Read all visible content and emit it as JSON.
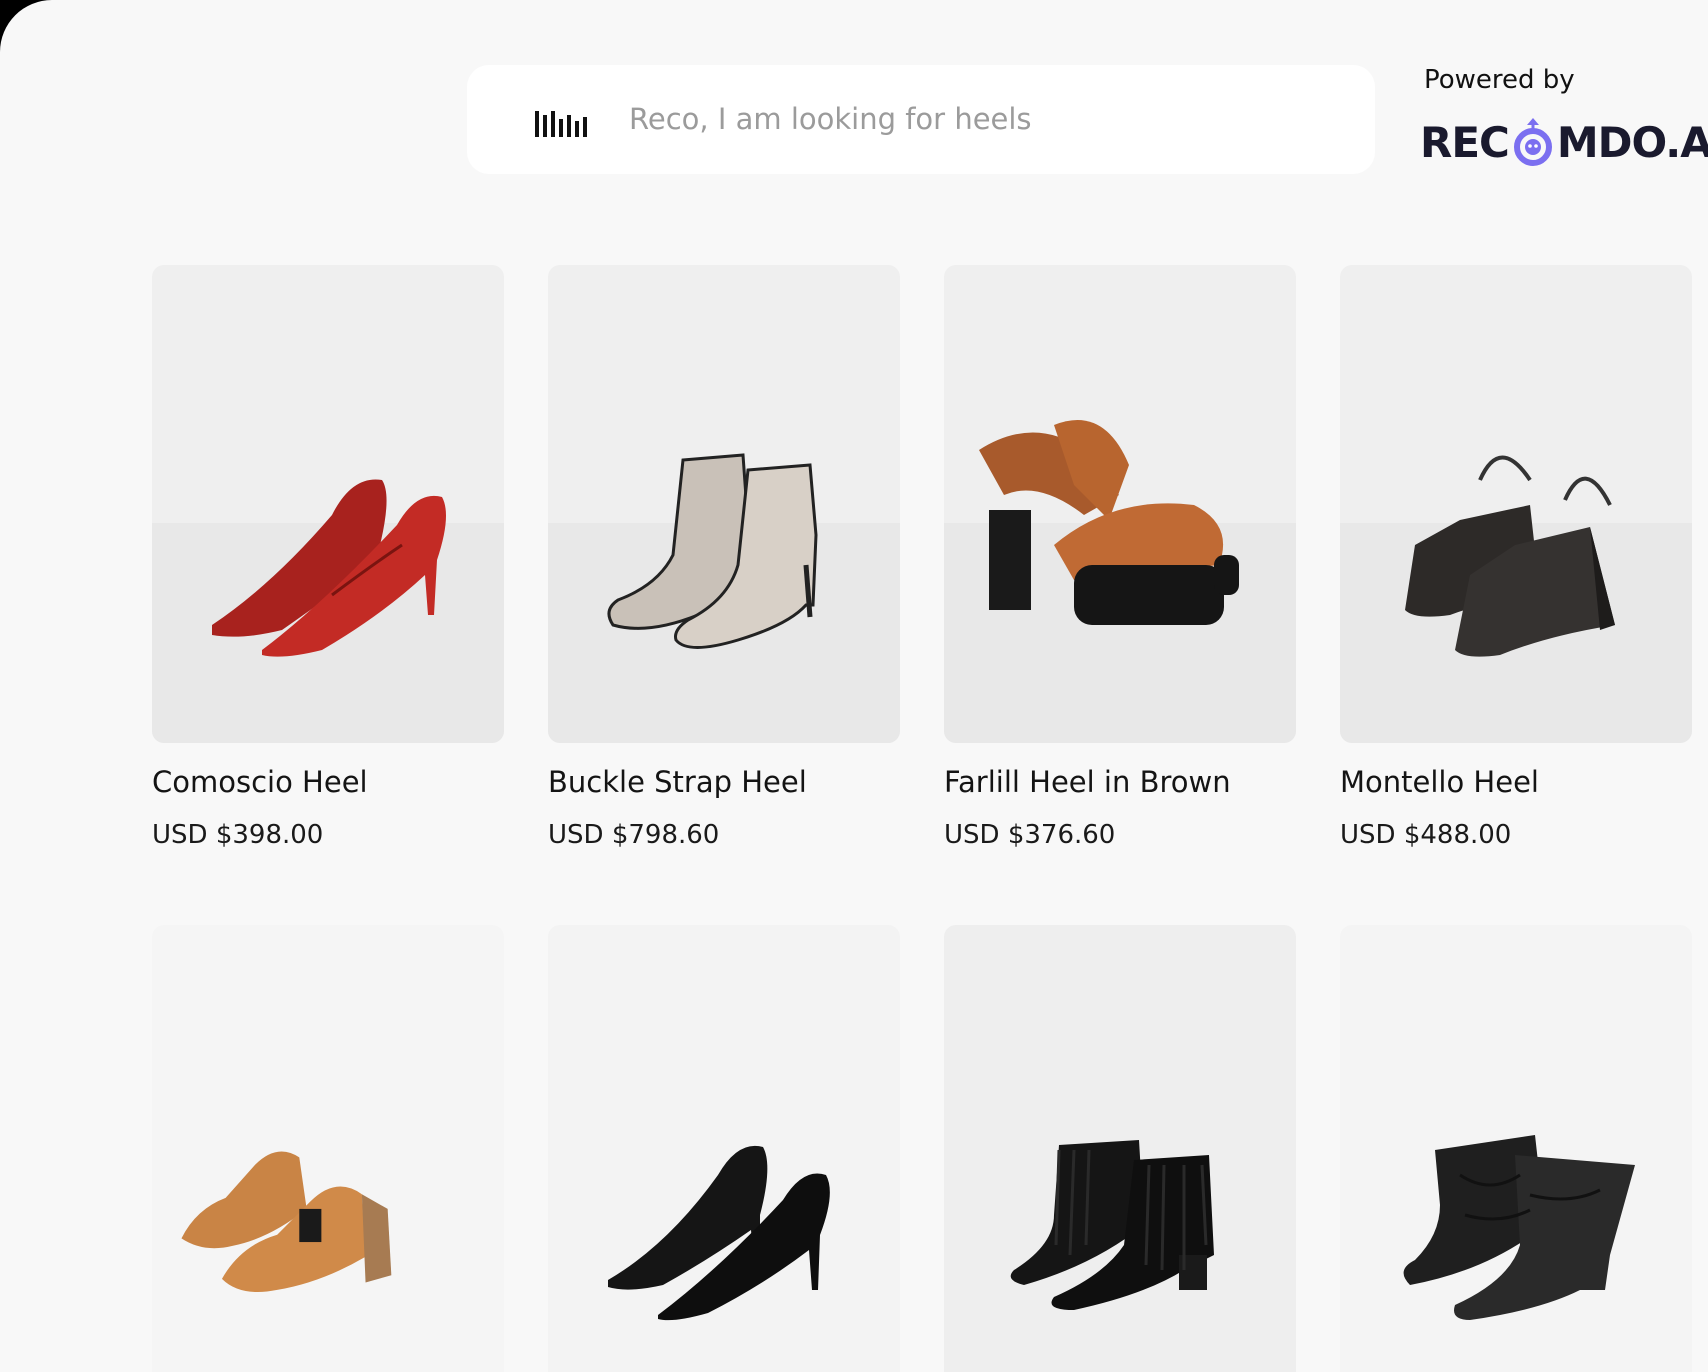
{
  "search": {
    "placeholder": "Reco, I am looking for heels",
    "value": ""
  },
  "branding": {
    "powered_label": "Powered by",
    "name_prefix": "REC",
    "name_suffix": "MDO.AI",
    "logo_icon": "robot-o-icon",
    "accent_color": "#7b6ff0"
  },
  "products": [
    {
      "name": "Comoscio Heel",
      "price": "USD $398.00",
      "icon": "red-pump-heel-image"
    },
    {
      "name": "Buckle Strap Heel",
      "price": "USD $798.60",
      "icon": "beige-ankle-boot-image"
    },
    {
      "name": "Farlill Heel in Brown",
      "price": "USD $376.60",
      "icon": "brown-platform-sandal-image"
    },
    {
      "name": "Montello Heel",
      "price": "USD $488.00",
      "icon": "black-slingback-wedge-image"
    },
    {
      "name": "",
      "price": "",
      "icon": "tan-strap-sandal-image"
    },
    {
      "name": "",
      "price": "",
      "icon": "black-pump-heel-image"
    },
    {
      "name": "",
      "price": "",
      "icon": "black-fringe-boot-image"
    },
    {
      "name": "",
      "price": "",
      "icon": "black-slouch-boot-image"
    }
  ]
}
